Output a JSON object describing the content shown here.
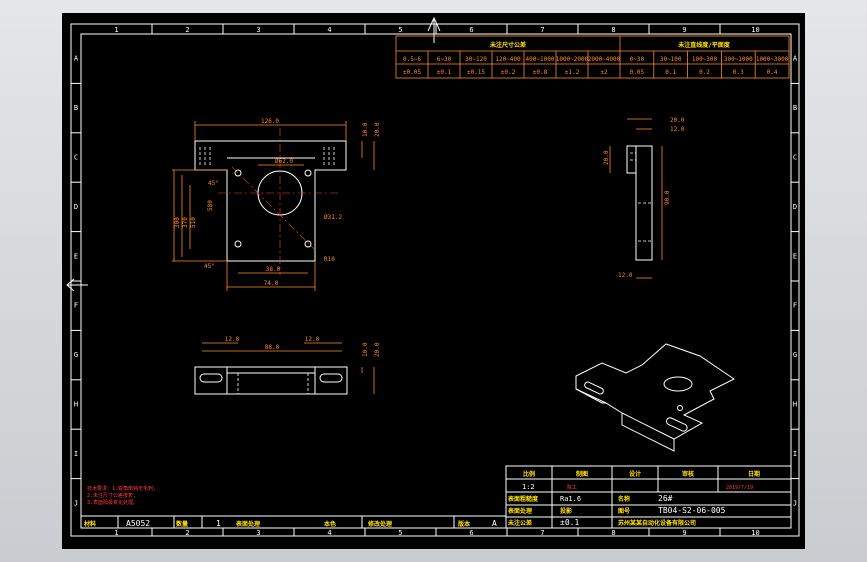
{
  "colors": {
    "background": "#000000",
    "frame": "#ffffff",
    "dimension": "#ff8a1f",
    "centerline": "#ff3b3b",
    "accent_text": "#ffe000",
    "workspace": "#d6d9dc"
  },
  "grid_cols": [
    "1",
    "2",
    "3",
    "4",
    "5",
    "6",
    "7",
    "8",
    "9",
    "10"
  ],
  "grid_rows": [
    "A",
    "B",
    "C",
    "D",
    "E",
    "F",
    "G",
    "H",
    "I",
    "J"
  ],
  "tolerance_table": {
    "linear_title": "未注尺寸公差",
    "flatness_title": "未注直线度/平面度",
    "linear_ranges": [
      "0.5~6",
      "6~30",
      "30~120",
      "120~400",
      "400~1000",
      "1000~2000",
      "2000~4000"
    ],
    "linear_values": [
      "±0.05",
      "±0.1",
      "±0.15",
      "±0.2",
      "±0.8",
      "±1.2",
      "±2"
    ],
    "flat_ranges": [
      "0~30",
      "30~100",
      "100~300",
      "300~1000",
      "1000~3000"
    ],
    "flat_values": [
      "0.05",
      "0.1",
      "0.2",
      "0.3",
      "0.4"
    ]
  },
  "front_view": {
    "dims": {
      "top_width": "126.0",
      "height_a": "10.0",
      "height_b": "20.0",
      "bore": "Ø62.0",
      "angle": "45°",
      "hole": "Ø31.2",
      "side_a": "300",
      "side_b": "370",
      "side_c": "510",
      "inner_h": "580",
      "inner_w": "38.0",
      "outer_w": "74.0",
      "radius": "R10",
      "angle2": "45°"
    }
  },
  "side_view": {
    "dims": {
      "top_a": "20.0",
      "top_b": "12.0",
      "left": "20.0",
      "height": "90.0",
      "bottom": "12.0"
    }
  },
  "bottom_view": {
    "dims": {
      "left": "12.0",
      "right": "12.0",
      "center": "88.0",
      "h_a": "10.0",
      "h_b": "20.0"
    }
  },
  "notes": [
    "技术要求：1.锐角倒钝无毛刺；",
    "2.未注尺寸公差按表；",
    "3.表面阳极氧化处理。"
  ],
  "title_block": {
    "headers": [
      "比例",
      "制图",
      "设计",
      "审核",
      "日期"
    ],
    "scale": "1:2",
    "drafter": "陈工",
    "date": "2019/7/19",
    "roughness_label": "表面粗糙度",
    "roughness_value": "Ra1.6",
    "projection_label": "投影",
    "name_label": "名称",
    "part_no": "26#",
    "tolerance_label": "未注公差",
    "tolerance_value": "±0.1",
    "drawing_label": "图号",
    "drawing_no": "TB04-S2-06-005",
    "plating": "表面处理",
    "company": "苏州某某自动化设备有限公司"
  },
  "bottom_row": {
    "material_label": "材料",
    "material": "A5052",
    "qty_label": "数量",
    "qty": "1",
    "surface_label": "表面处理",
    "surface": "本色",
    "revision_label": "修改处理",
    "version_label": "版本",
    "version": "A"
  }
}
